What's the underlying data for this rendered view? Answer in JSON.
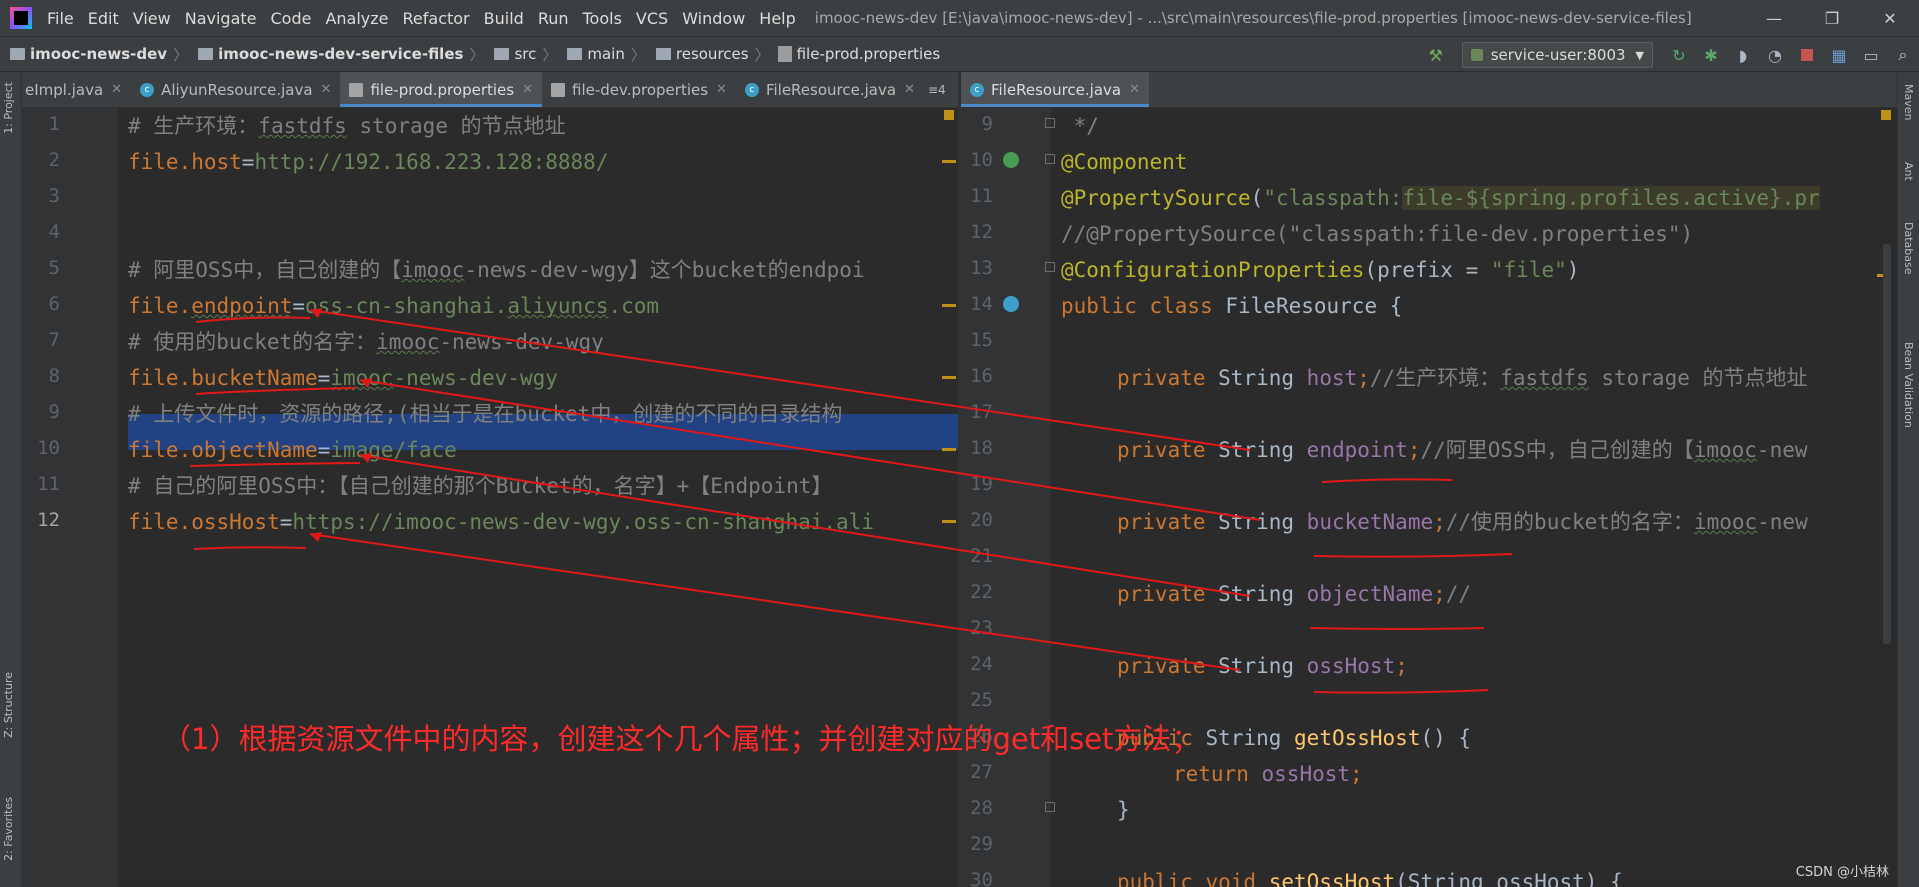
{
  "menu": [
    "File",
    "Edit",
    "View",
    "Navigate",
    "Code",
    "Analyze",
    "Refactor",
    "Build",
    "Run",
    "Tools",
    "VCS",
    "Window",
    "Help"
  ],
  "window_title": "imooc-news-dev [E:\\java\\imooc-news-dev] - ...\\src\\main\\resources\\file-prod.properties [imooc-news-dev-service-files]",
  "window_controls": [
    "—",
    "❐",
    "✕"
  ],
  "breadcrumb": [
    "imooc-news-dev",
    "imooc-news-dev-service-files",
    "src",
    "main",
    "resources",
    "file-prod.properties"
  ],
  "run_config": "service-user:8003",
  "left_tool_labels": [
    "1: Project",
    "Z: Structure",
    "2: Favorites"
  ],
  "right_tool_labels": [
    "Maven",
    "Ant",
    "Database",
    "Bean Validation"
  ],
  "left_tabs": [
    "eImpl.java",
    "AliyunResource.java",
    "file-prod.properties",
    "file-dev.properties",
    "FileResource.java"
  ],
  "left_tabs_overflow": "≡4",
  "right_tabs": [
    "FileResource.java"
  ],
  "left_editor": {
    "line_numbers": [
      "1",
      "2",
      "3",
      "4",
      "5",
      "6",
      "7",
      "8",
      "9",
      "10",
      "11",
      "12"
    ],
    "lines": [
      {
        "key": "# 生产环境：",
        "sq": "fastdfs",
        "rest": " storage 的节点地址"
      },
      {
        "key": "file.host",
        "value": "http://192.168.223.128:8888/"
      },
      {},
      {},
      {
        "c1": "# 阿里OSS中，自己创建的【",
        "c2": "imooc",
        "c3": "-news-dev-wgy】这个bucket的endpoi"
      },
      {
        "k1": "file.",
        "k2": "endpoint",
        "v1": "oss-cn-shanghai.",
        "v2": "aliyuncs",
        "v3": ".com"
      },
      {
        "c1": "# 使用的bucket的名字：",
        "c2": "imooc",
        "c3": "-news-dev-wgy"
      },
      {
        "k1": "file.",
        "k2": "bucketName",
        "v2": "imooc",
        "v3": "-news-dev-wgy"
      },
      {
        "text": "# 上传文件时，资源的路径;(相当于是在bucket中，创建的不同的目录结构"
      },
      {
        "k1": "file.",
        "k2": "objectName",
        "v1": "image/face"
      },
      {
        "text": "# 自己的阿里OSS中：【自己创建的那个Bucket的，名字】+【Endpoint】"
      },
      {
        "k1": "file.",
        "k2": "ossHost",
        "v1": "https://imooc-news-dev-wgy.oss-cn-shanghai.ali"
      }
    ]
  },
  "right_editor": {
    "line_numbers": [
      "9",
      "10",
      "11",
      "12",
      "13",
      "14",
      "15",
      "16",
      "17",
      "18",
      "19",
      "20",
      "21",
      "22",
      "23",
      "24",
      "25",
      "26",
      "27",
      "28",
      "29",
      "30"
    ],
    "lines": {
      "l9": " */",
      "l10": "@Component",
      "l11_ann": "@PropertySource",
      "l11_a": "(",
      "l11_b": "\"classpath:",
      "l11_c": "file-${spring.profiles.active}.pr",
      "l12": "//@PropertySource(\"classpath:file-dev.properties\")",
      "l13_ann": "@ConfigurationProperties",
      "l13_a": "(",
      "l13_b": "prefix",
      "l13_c": " = ",
      "l13_d": "\"file\"",
      "l13_e": ")",
      "l14_kw": "public class ",
      "l14_name": "FileResource {",
      "f_kw": "private ",
      "f_type": "String ",
      "l16_field": "host",
      "l16_c1": "//生产环境：",
      "l16_c2": "fastdfs",
      "l16_c3": " storage 的节点地址",
      "l18_field": "endpoint",
      "l18_c1": "//阿里OSS中，自己创建的【",
      "l18_c2": "imooc",
      "l18_c3": "-new",
      "l20_field": "bucketName",
      "l20_c1": "//使用的bucket的名字：",
      "l20_c2": "imooc",
      "l20_c3": "-new",
      "l22_field": "objectName",
      "l22_c1": "//",
      "l24_field": "ossHost",
      "semi": ";",
      "l26_kw": "public ",
      "l26_type": "String ",
      "l26_m": "getOssHost",
      "l26_end": "() {",
      "l27_kw": "return ",
      "l27_f": "ossHost",
      "l27_end": ";",
      "l28": "}",
      "l30_kw": "public void ",
      "l30_m": "setOssHost",
      "l30_end": "(String ossHost) {"
    }
  },
  "annotation": "（1）根据资源文件中的内容，创建这个几个属性；并创建对应的get和set方法；",
  "watermark": "CSDN @小桔林"
}
